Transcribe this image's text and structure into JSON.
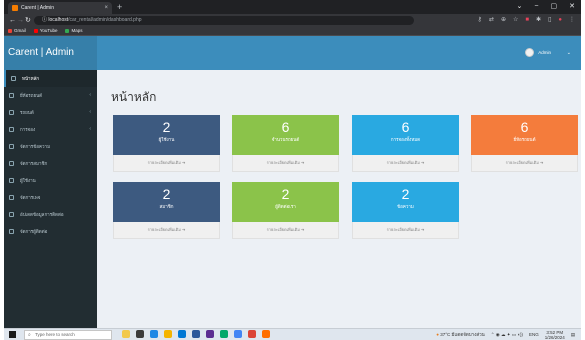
{
  "browser": {
    "tab_title": "Carent | Admin",
    "tab_close": "×",
    "new_tab": "+",
    "window_controls": [
      "⌄",
      "−",
      "▢",
      "✕"
    ],
    "url_host": "localhost",
    "url_path": "/car_rental/admin/dashboard.php",
    "bookmarks": [
      "Gmail",
      "YouTube",
      "Maps"
    ]
  },
  "app": {
    "logo": "Carent | Admin",
    "user_name": "Admin",
    "page_title": "หน้าหลัก"
  },
  "sidebar": {
    "items": [
      {
        "label": "หน้าหลัก"
      },
      {
        "label": "ยี่ห้อรถยนต์"
      },
      {
        "label": "รถยนต์"
      },
      {
        "label": "การจอง"
      },
      {
        "label": "จัดการข้อความ"
      },
      {
        "label": "จัดการสมาชิก"
      },
      {
        "label": "ผู้ใช้งาน"
      },
      {
        "label": "จัดการเพจ"
      },
      {
        "label": "อัปเดตข้อมูลการติดต่อ"
      },
      {
        "label": "จัดการผู้ติดต่อ"
      }
    ]
  },
  "boxes": [
    {
      "count": "2",
      "label": "ผู้ใช้งาน",
      "more": "รายละเอียดเพิ่มเติม ➔",
      "color": "#3d5a80"
    },
    {
      "count": "6",
      "label": "จำนวนรถยนต์",
      "more": "รายละเอียดเพิ่มเติม ➔",
      "color": "#8bc34a"
    },
    {
      "count": "6",
      "label": "การจองทั้งหมด",
      "more": "รายละเอียดเพิ่มเติม ➔",
      "color": "#29a9e1"
    },
    {
      "count": "6",
      "label": "ยี่ห้อรถยนต์",
      "more": "รายละเอียดเพิ่มเติม ➔",
      "color": "#f47c3c"
    },
    {
      "count": "2",
      "label": "สมาชิก",
      "more": "รายละเอียดเพิ่มเติม ➔",
      "color": "#3d5a80"
    },
    {
      "count": "2",
      "label": "ผู้ติดต่อเรา",
      "more": "รายละเอียดเพิ่มเติม ➔",
      "color": "#8bc34a"
    },
    {
      "count": "2",
      "label": "ข้อความ",
      "more": "รายละเอียดเพิ่มเติม ➔",
      "color": "#29a9e1"
    }
  ],
  "taskbar": {
    "search_placeholder": "Type here to search",
    "weather": "37°C มีแดดจัดบางส่วน",
    "lang": "ENG",
    "time": "3:52 PM",
    "date": "1/26/2024"
  }
}
